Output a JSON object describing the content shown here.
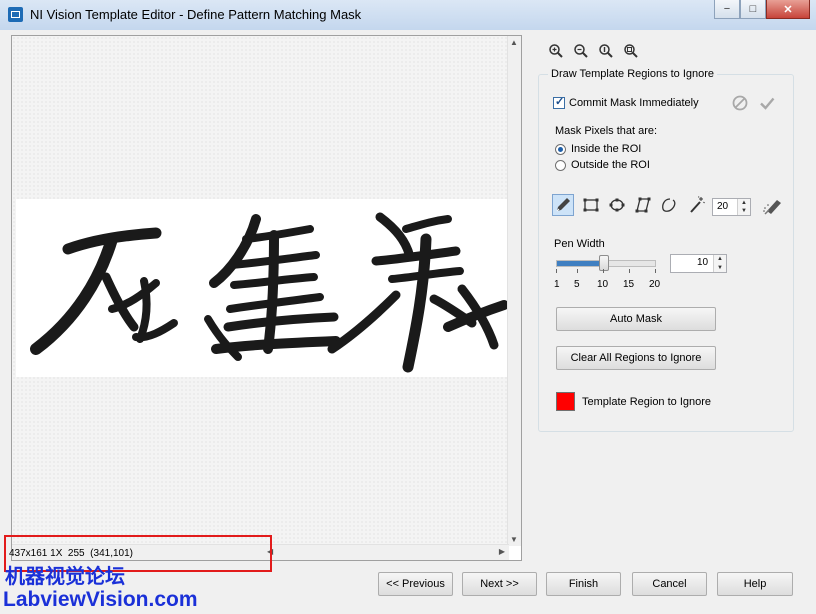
{
  "window": {
    "title": "NI Vision Template Editor - Define Pattern Matching Mask",
    "controls": {
      "minimize": "−",
      "maximize": "□",
      "close": "✕"
    }
  },
  "canvas": {
    "status_text": "437x161 1X  255  (341,101)",
    "scroll_up": "▲",
    "scroll_down": "▼",
    "scroll_left": "◀",
    "scroll_right": "▶"
  },
  "zoom_tools": [
    "zoom-in-icon",
    "zoom-out-icon",
    "zoom-1to1-icon",
    "zoom-fit-icon"
  ],
  "panel": {
    "group_title": "Draw Template Regions to Ignore",
    "commit_label": "Commit Mask Immediately",
    "commit_checked": true,
    "mask_pixels_label": "Mask Pixels that are:",
    "inside_label": "Inside the ROI",
    "outside_label": "Outside the ROI",
    "selected_mode": "inside",
    "tools": [
      "pen-icon",
      "rectangle-icon",
      "oval-icon",
      "polygon-icon",
      "freehand-icon",
      "magic-wand-icon"
    ],
    "wand_tolerance": "20",
    "pen_width_label": "Pen Width",
    "pen_width_value": "10",
    "pen_width_ticks": [
      "1",
      "5",
      "10",
      "15",
      "20"
    ],
    "auto_mask_label": "Auto Mask",
    "clear_regions_label": "Clear All Regions to Ignore",
    "region_color_label": "Template Region to Ignore",
    "region_color": "#ff0000"
  },
  "footer": {
    "previous": "<< Previous",
    "next": "Next >>",
    "finish": "Finish",
    "cancel": "Cancel",
    "help": "Help"
  },
  "watermark": {
    "line1": "机器视觉论坛",
    "line2": "LabviewVision.com"
  }
}
